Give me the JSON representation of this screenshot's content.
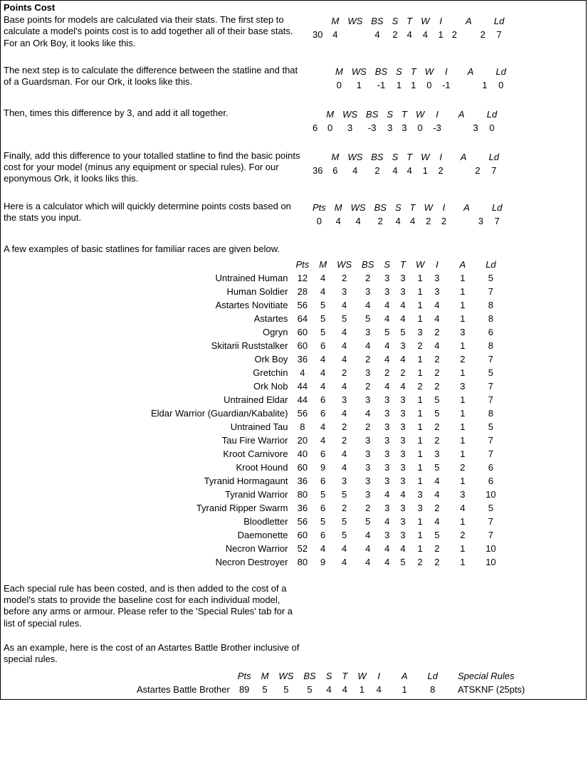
{
  "title": "Points Cost",
  "headers": {
    "M": "M",
    "WS": "WS",
    "BS": "BS",
    "S": "S",
    "T": "T",
    "W": "W",
    "I": "I",
    "A": "A",
    "Ld": "Ld",
    "Pts": "Pts",
    "SpecialRules": "Special Rules"
  },
  "step1": {
    "desc": "Base points for models are calculated via their stats. The first step to calculate a model's points cost is to add together all of their base stats. For an Ork Boy, it looks like this.",
    "row": {
      "M": "30",
      "WS": "4",
      "BS": "4",
      "S": "2",
      "T": "4",
      "W": "4",
      "I": "1",
      "A": "2",
      "A2": "2",
      "Ld": "7"
    }
  },
  "step2": {
    "desc": "The next step is to calculate the difference between the statline and that of a Guardsman. For our Ork, it looks like this.",
    "row": {
      "M": "0",
      "WS": "1",
      "BS": "-1",
      "S": "1",
      "T": "1",
      "W": "0",
      "I": "-1",
      "A": "",
      "A2": "1",
      "Ld": "0"
    }
  },
  "step3": {
    "desc": "Then, times this difference by 3, and add it all together.",
    "row": {
      "Sum": "6",
      "M": "0",
      "WS": "3",
      "BS": "-3",
      "S": "3",
      "T": "3",
      "W": "0",
      "I": "-3",
      "A": "",
      "A2": "3",
      "Ld": "0"
    }
  },
  "step4": {
    "desc": "Finally, add this difference to your totalled statline to find the basic points cost for your model (minus any equipment or special rules). For our eponymous Ork, it looks liks this.",
    "row": {
      "Sum": "36",
      "M": "6",
      "WS": "4",
      "BS": "2",
      "S": "4",
      "T": "4",
      "W": "1",
      "I": "2",
      "A": "",
      "A2": "2",
      "Ld": "7"
    }
  },
  "calc": {
    "desc": "Here is a calculator which will quickly determine points costs based on the stats you input.",
    "row": {
      "Pts": "0",
      "M": "4",
      "WS": "4",
      "BS": "2",
      "S": "4",
      "T": "4",
      "W": "2",
      "I": "2",
      "A": "",
      "A2": "3",
      "Ld": "7"
    }
  },
  "examples_intro": "A few examples of basic statlines for familiar races are given below.",
  "examples": [
    {
      "name": "Untrained Human",
      "Pts": "12",
      "M": "4",
      "WS": "2",
      "BS": "2",
      "S": "3",
      "T": "3",
      "W": "1",
      "I": "3",
      "A": "1",
      "Ld": "5"
    },
    {
      "name": "Human Soldier",
      "Pts": "28",
      "M": "4",
      "WS": "3",
      "BS": "3",
      "S": "3",
      "T": "3",
      "W": "1",
      "I": "3",
      "A": "1",
      "Ld": "7"
    },
    {
      "name": "Astartes Novitiate",
      "Pts": "56",
      "M": "5",
      "WS": "4",
      "BS": "4",
      "S": "4",
      "T": "4",
      "W": "1",
      "I": "4",
      "A": "1",
      "Ld": "8"
    },
    {
      "name": "Astartes",
      "Pts": "64",
      "M": "5",
      "WS": "5",
      "BS": "5",
      "S": "4",
      "T": "4",
      "W": "1",
      "I": "4",
      "A": "1",
      "Ld": "8"
    },
    {
      "name": "Ogryn",
      "Pts": "60",
      "M": "5",
      "WS": "4",
      "BS": "3",
      "S": "5",
      "T": "5",
      "W": "3",
      "I": "2",
      "A": "3",
      "Ld": "6"
    },
    {
      "name": "Skitarii Ruststalker",
      "Pts": "60",
      "M": "6",
      "WS": "4",
      "BS": "4",
      "S": "4",
      "T": "3",
      "W": "2",
      "I": "4",
      "A": "1",
      "Ld": "8"
    },
    {
      "name": "Ork Boy",
      "Pts": "36",
      "M": "4",
      "WS": "4",
      "BS": "2",
      "S": "4",
      "T": "4",
      "W": "1",
      "I": "2",
      "A": "2",
      "Ld": "7"
    },
    {
      "name": "Gretchin",
      "Pts": "4",
      "M": "4",
      "WS": "2",
      "BS": "3",
      "S": "2",
      "T": "2",
      "W": "1",
      "I": "2",
      "A": "1",
      "Ld": "5"
    },
    {
      "name": "Ork Nob",
      "Pts": "44",
      "M": "4",
      "WS": "4",
      "BS": "2",
      "S": "4",
      "T": "4",
      "W": "2",
      "I": "2",
      "A": "3",
      "Ld": "7"
    },
    {
      "name": "Untrained Eldar",
      "Pts": "44",
      "M": "6",
      "WS": "3",
      "BS": "3",
      "S": "3",
      "T": "3",
      "W": "1",
      "I": "5",
      "A": "1",
      "Ld": "7"
    },
    {
      "name": "Eldar Warrior (Guardian/Kabalite)",
      "Pts": "56",
      "M": "6",
      "WS": "4",
      "BS": "4",
      "S": "3",
      "T": "3",
      "W": "1",
      "I": "5",
      "A": "1",
      "Ld": "8"
    },
    {
      "name": "Untrained Tau",
      "Pts": "8",
      "M": "4",
      "WS": "2",
      "BS": "2",
      "S": "3",
      "T": "3",
      "W": "1",
      "I": "2",
      "A": "1",
      "Ld": "5"
    },
    {
      "name": "Tau Fire Warrior",
      "Pts": "20",
      "M": "4",
      "WS": "2",
      "BS": "3",
      "S": "3",
      "T": "3",
      "W": "1",
      "I": "2",
      "A": "1",
      "Ld": "7"
    },
    {
      "name": "Kroot Carnivore",
      "Pts": "40",
      "M": "6",
      "WS": "4",
      "BS": "3",
      "S": "3",
      "T": "3",
      "W": "1",
      "I": "3",
      "A": "1",
      "Ld": "7"
    },
    {
      "name": "Kroot Hound",
      "Pts": "60",
      "M": "9",
      "WS": "4",
      "BS": "3",
      "S": "3",
      "T": "3",
      "W": "1",
      "I": "5",
      "A": "2",
      "Ld": "6"
    },
    {
      "name": "Tyranid Hormagaunt",
      "Pts": "36",
      "M": "6",
      "WS": "3",
      "BS": "3",
      "S": "3",
      "T": "3",
      "W": "1",
      "I": "4",
      "A": "1",
      "Ld": "6"
    },
    {
      "name": "Tyranid Warrior",
      "Pts": "80",
      "M": "5",
      "WS": "5",
      "BS": "3",
      "S": "4",
      "T": "4",
      "W": "3",
      "I": "4",
      "A": "3",
      "Ld": "10"
    },
    {
      "name": "Tyranid Ripper Swarm",
      "Pts": "36",
      "M": "6",
      "WS": "2",
      "BS": "2",
      "S": "3",
      "T": "3",
      "W": "3",
      "I": "2",
      "A": "4",
      "Ld": "5"
    },
    {
      "name": "Bloodletter",
      "Pts": "56",
      "M": "5",
      "WS": "5",
      "BS": "5",
      "S": "4",
      "T": "3",
      "W": "1",
      "I": "4",
      "A": "1",
      "Ld": "7"
    },
    {
      "name": "Daemonette",
      "Pts": "60",
      "M": "6",
      "WS": "5",
      "BS": "4",
      "S": "3",
      "T": "3",
      "W": "1",
      "I": "5",
      "A": "2",
      "Ld": "7"
    },
    {
      "name": "Necron Warrior",
      "Pts": "52",
      "M": "4",
      "WS": "4",
      "BS": "4",
      "S": "4",
      "T": "4",
      "W": "1",
      "I": "2",
      "A": "1",
      "Ld": "10"
    },
    {
      "name": "Necron Destroyer",
      "Pts": "80",
      "M": "9",
      "WS": "4",
      "BS": "4",
      "S": "4",
      "T": "5",
      "W": "2",
      "I": "2",
      "A": "1",
      "Ld": "10"
    }
  ],
  "special_rules_para": "Each special rule has been costed, and is then added to the cost of a model's stats to provide the baseline cost for each individual model, before any arms or armour. Please refer to the 'Special Rules' tab for a list of special rules.",
  "final_intro": "As an example, here is the cost of an Astartes Battle Brother inclusive of special rules.",
  "final": {
    "name": "Astartes Battle Brother",
    "Pts": "89",
    "M": "5",
    "WS": "5",
    "BS": "5",
    "S": "4",
    "T": "4",
    "W": "1",
    "I": "4",
    "A": "1",
    "Ld": "8",
    "SR": "ATSKNF (25pts)"
  }
}
